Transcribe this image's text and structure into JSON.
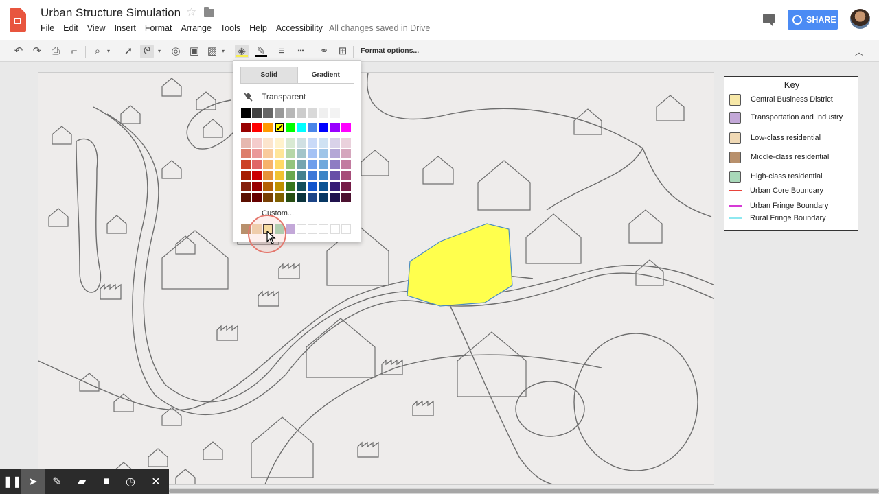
{
  "app": {
    "title": "Urban Structure Simulation",
    "saved_status": "All changes saved in Drive",
    "share_label": "SHARE"
  },
  "menu": [
    "File",
    "Edit",
    "View",
    "Insert",
    "Format",
    "Arrange",
    "Tools",
    "Help",
    "Accessibility"
  ],
  "toolbar": {
    "format_options": "Format options...",
    "icons": [
      "undo-icon",
      "redo-icon",
      "print-icon",
      "paint-format-icon",
      "zoom-icon",
      "select-icon",
      "line-icon",
      "shape-icon",
      "text-box-icon",
      "image-icon",
      "fill-color-icon",
      "border-color-icon",
      "border-weight-icon",
      "border-dash-icon",
      "link-icon",
      "comment-add-icon"
    ],
    "fill_color": "#f7ef51",
    "border_color": "#000000"
  },
  "fill_palette": {
    "tabs": [
      "Solid",
      "Gradient"
    ],
    "active_tab": "Solid",
    "transparent_label": "Transparent",
    "custom_label": "Custom...",
    "selected_color": "#ffff00",
    "gray_row": [
      "#000000",
      "#434343",
      "#666666",
      "#999999",
      "#b7b7b7",
      "#cccccc",
      "#d9d9d9",
      "#efefef",
      "#f3f3f3",
      "#ffffff"
    ],
    "bright_row": [
      "#980000",
      "#ff0000",
      "#ff9900",
      "#ffff00",
      "#00ff00",
      "#00ffff",
      "#4a86e8",
      "#0000ff",
      "#9900ff",
      "#ff00ff"
    ],
    "shade_rows": [
      [
        "#e6b8af",
        "#f4cccc",
        "#fce5cd",
        "#fff2cc",
        "#d9ead3",
        "#d0e0e3",
        "#c9daf8",
        "#cfe2f3",
        "#d9d2e9",
        "#ead1dc"
      ],
      [
        "#dd7e6b",
        "#ea9999",
        "#f9cb9c",
        "#ffe599",
        "#b6d7a8",
        "#a2c4c9",
        "#a4c2f4",
        "#9fc5e8",
        "#b4a7d6",
        "#d5a6bd"
      ],
      [
        "#cc4125",
        "#e06666",
        "#f6b26b",
        "#ffd966",
        "#93c47d",
        "#76a5af",
        "#6d9eeb",
        "#6fa8dc",
        "#8e7cc3",
        "#c27ba0"
      ],
      [
        "#a61c00",
        "#cc0000",
        "#e69138",
        "#f1c232",
        "#6aa84f",
        "#45818e",
        "#3c78d8",
        "#3d85c6",
        "#674ea7",
        "#a64d79"
      ],
      [
        "#85200c",
        "#990000",
        "#b45f06",
        "#bf9000",
        "#38761d",
        "#134f5c",
        "#1155cc",
        "#0b5394",
        "#351c75",
        "#741b47"
      ],
      [
        "#5b0f00",
        "#660000",
        "#783f04",
        "#7f6000",
        "#274e13",
        "#0c343d",
        "#1c4587",
        "#073763",
        "#20124d",
        "#4c1130"
      ]
    ],
    "custom_row": [
      "#b8906c",
      "#f0d9b5",
      "#f7e8a8",
      "#a8d8b9",
      "#c3a8d8",
      "#ffffff",
      "#ffffff",
      "#ffffff",
      "#ffffff",
      "#ffffff"
    ]
  },
  "key": {
    "title": "Key",
    "items": [
      {
        "label": "Central Business District",
        "color": "#f7e8a8",
        "kind": "swatch"
      },
      {
        "label": "Transportation and Industry",
        "color": "#c3a8d8",
        "kind": "swatch"
      },
      {
        "label": "Low-class residential",
        "color": "#f0d9b5",
        "kind": "swatch"
      },
      {
        "label": "Middle-class residential",
        "color": "#b8906c",
        "kind": "swatch"
      },
      {
        "label": "High-class residential",
        "color": "#a8d8b9",
        "kind": "swatch"
      },
      {
        "label": "Urban Core Boundary",
        "color": "#e8433b",
        "kind": "line"
      },
      {
        "label": "Urban Fringe Boundary",
        "color": "#d63ad6",
        "kind": "line"
      },
      {
        "label": "Rural Fringe Boundary",
        "color": "#8ee8f0",
        "kind": "line"
      }
    ]
  },
  "drawing": {
    "cbd_fill": "#ffff4d"
  },
  "recorder": {
    "buttons": [
      "pause-icon",
      "pointer-icon",
      "pen-icon",
      "highlighter-icon",
      "camera-icon",
      "timer-icon",
      "close-icon"
    ]
  }
}
